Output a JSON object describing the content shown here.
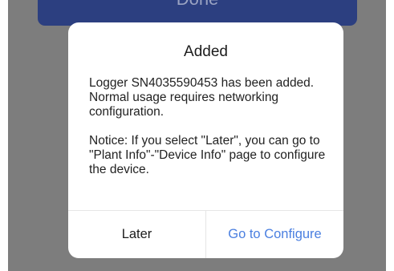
{
  "background": {
    "button_label": "Done"
  },
  "dialog": {
    "title": "Added",
    "message": "Logger SN4035590453 has been added. Normal usage requires networking configuration.",
    "notice": "Notice: If you select \"Later\", you can go to \"Plant Info\"-\"Device Info\" page to configure the device.",
    "later_label": "Later",
    "configure_label": "Go to Configure"
  },
  "colors": {
    "overlay": "#7d7d7d",
    "background_button": "#2c3f80",
    "accent": "#4a7fe0"
  }
}
